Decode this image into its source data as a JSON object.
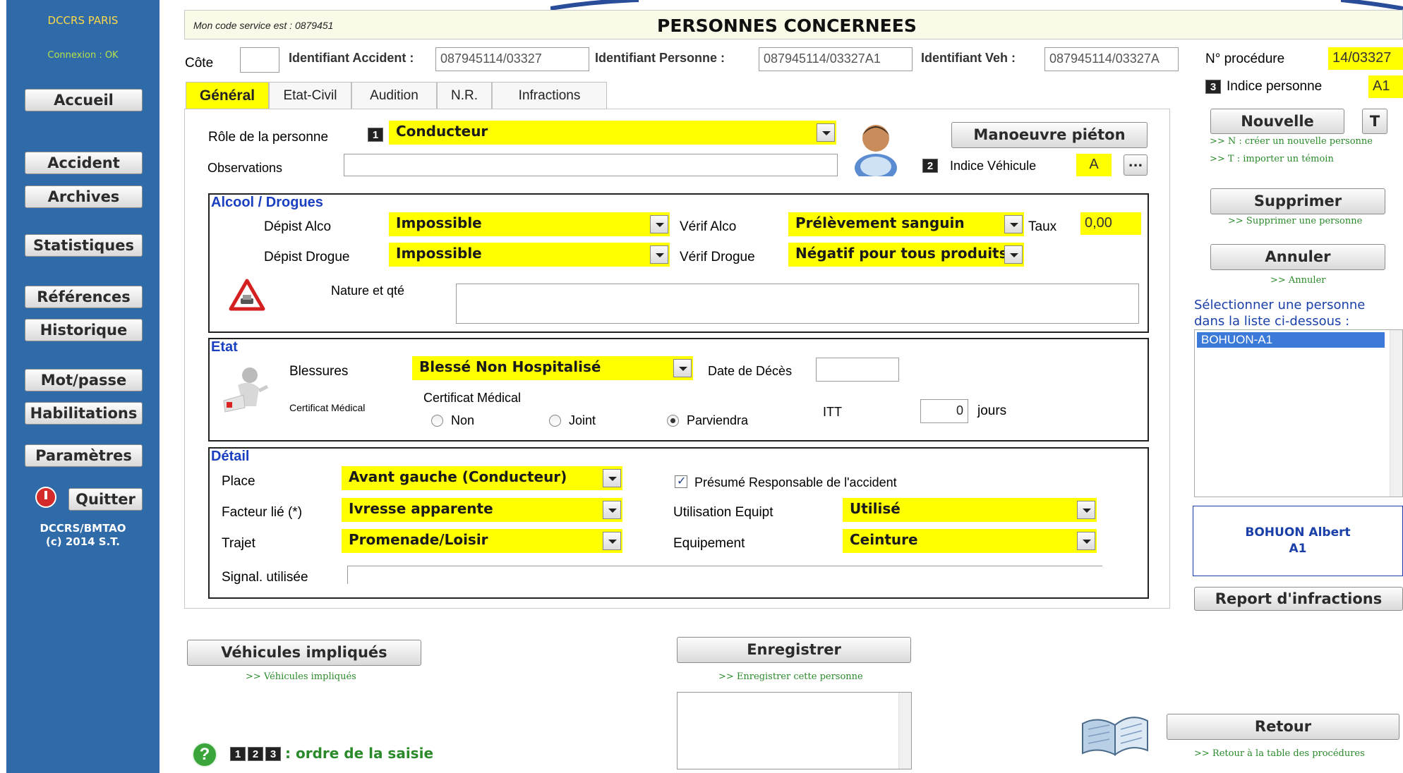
{
  "sidebar": {
    "org": "DCCRS PARIS",
    "connection": "Connexion : OK",
    "buttons": {
      "accueil": "Accueil",
      "accident": "Accident",
      "archives": "Archives",
      "statistiques": "Statistiques",
      "references": "Références",
      "historique": "Historique",
      "motpasse": "Mot/passe",
      "habilitations": "Habilitations",
      "parametres": "Paramètres",
      "quitter": "Quitter"
    },
    "footer_line1": "DCCRS/BMTAO",
    "footer_line2": "(c) 2014 S.T."
  },
  "header": {
    "service_code": "Mon code service est : 0879451",
    "title": "PERSONNES CONCERNEES"
  },
  "ids": {
    "cote_label": "Côte",
    "cote_value": "",
    "accident_label": "Identifiant Accident :",
    "accident_value": "087945114/03327",
    "personne_label": "Identifiant Personne :",
    "personne_value": "087945114/03327A1",
    "veh_label": "Identifiant Veh :",
    "veh_value": "087945114/03327A",
    "procedure_label": "N° procédure",
    "procedure_value": "14/03327",
    "indice_label": "Indice personne",
    "indice_value": "A1"
  },
  "tabs": [
    "Général",
    "Etat-Civil",
    "Audition",
    "N.R.",
    "Infractions"
  ],
  "general": {
    "role_label": "Rôle de la personne",
    "role_value": "Conducteur",
    "observations_label": "Observations",
    "observations_value": "",
    "manoeuvre_btn": "Manoeuvre piéton",
    "indice_vehicule_label": "Indice Véhicule",
    "indice_vehicule_value": "A",
    "dots_btn": "..."
  },
  "alcool": {
    "title": "Alcool / Drogues",
    "depist_alco_label": "Dépist Alco",
    "depist_alco_value": "Impossible",
    "verif_alco_label": "Vérif Alco",
    "verif_alco_value": "Prélèvement sanguin",
    "taux_label": "Taux",
    "taux_value": "0,00",
    "depist_drogue_label": "Dépist Drogue",
    "depist_drogue_value": "Impossible",
    "verif_drogue_label": "Vérif Drogue",
    "verif_drogue_value": "Négatif pour tous produits",
    "nature_label": "Nature et qté",
    "nature_value": ""
  },
  "etat": {
    "title": "Etat",
    "blessures_label": "Blessures",
    "blessures_value": "Blessé Non Hospitalisé",
    "date_deces_label": "Date de Décès",
    "date_deces_value": "",
    "certif_icon_label": "Certificat Médical",
    "certif_label": "Certificat Médical",
    "radio_non": "Non",
    "radio_joint": "Joint",
    "radio_parviendra": "Parviendra",
    "radio_selected": "Parviendra",
    "itt_label": "ITT",
    "itt_value": "0",
    "jours_label": "jours"
  },
  "detail": {
    "title": "Détail",
    "place_label": "Place",
    "place_value": "Avant gauche (Conducteur)",
    "presume_label": "Présumé Responsable de l'accident",
    "presume_checked": true,
    "facteur_label": "Facteur lié (*)",
    "facteur_value": "Ivresse apparente",
    "utilisation_label": "Utilisation Equipt",
    "utilisation_value": "Utilisé",
    "trajet_label": "Trajet",
    "trajet_value": "Promenade/Loisir",
    "equipement_label": "Equipement",
    "equipement_value": "Ceinture",
    "signal_label": "Signal. utilisée",
    "signal_value": ""
  },
  "right": {
    "nouvelle_btn": "Nouvelle",
    "t_btn": "T",
    "hint_n": ">> N : créer un nouvelle personne",
    "hint_t": ">> T : importer un témoin",
    "supprimer_btn": "Supprimer",
    "hint_supprimer": ">> Supprimer une personne",
    "annuler_btn": "Annuler",
    "hint_annuler": ">> Annuler",
    "select_label_1": "Sélectionner une personne",
    "select_label_2": "dans la liste ci-dessous :",
    "list_items": [
      "BOHUON-A1"
    ],
    "selected_name": "BOHUON Albert",
    "selected_indice": "A1",
    "report_btn": "Report d'infractions"
  },
  "bottom": {
    "vehicules_btn": "Véhicules impliqués",
    "hint_vehicules": ">> Véhicules impliqués",
    "enregistrer_btn": "Enregistrer",
    "hint_enregistrer": ">> Enregistrer cette personne",
    "retour_btn": "Retour",
    "hint_retour": ">> Retour à la table des procédures",
    "ordre_label": ": ordre de la saisie"
  },
  "colors": {
    "sidebar": "#2e6ba8",
    "field_highlight": "#ffff00",
    "section_title": "#1a3fc0",
    "hint_green": "#2a8a2a"
  }
}
